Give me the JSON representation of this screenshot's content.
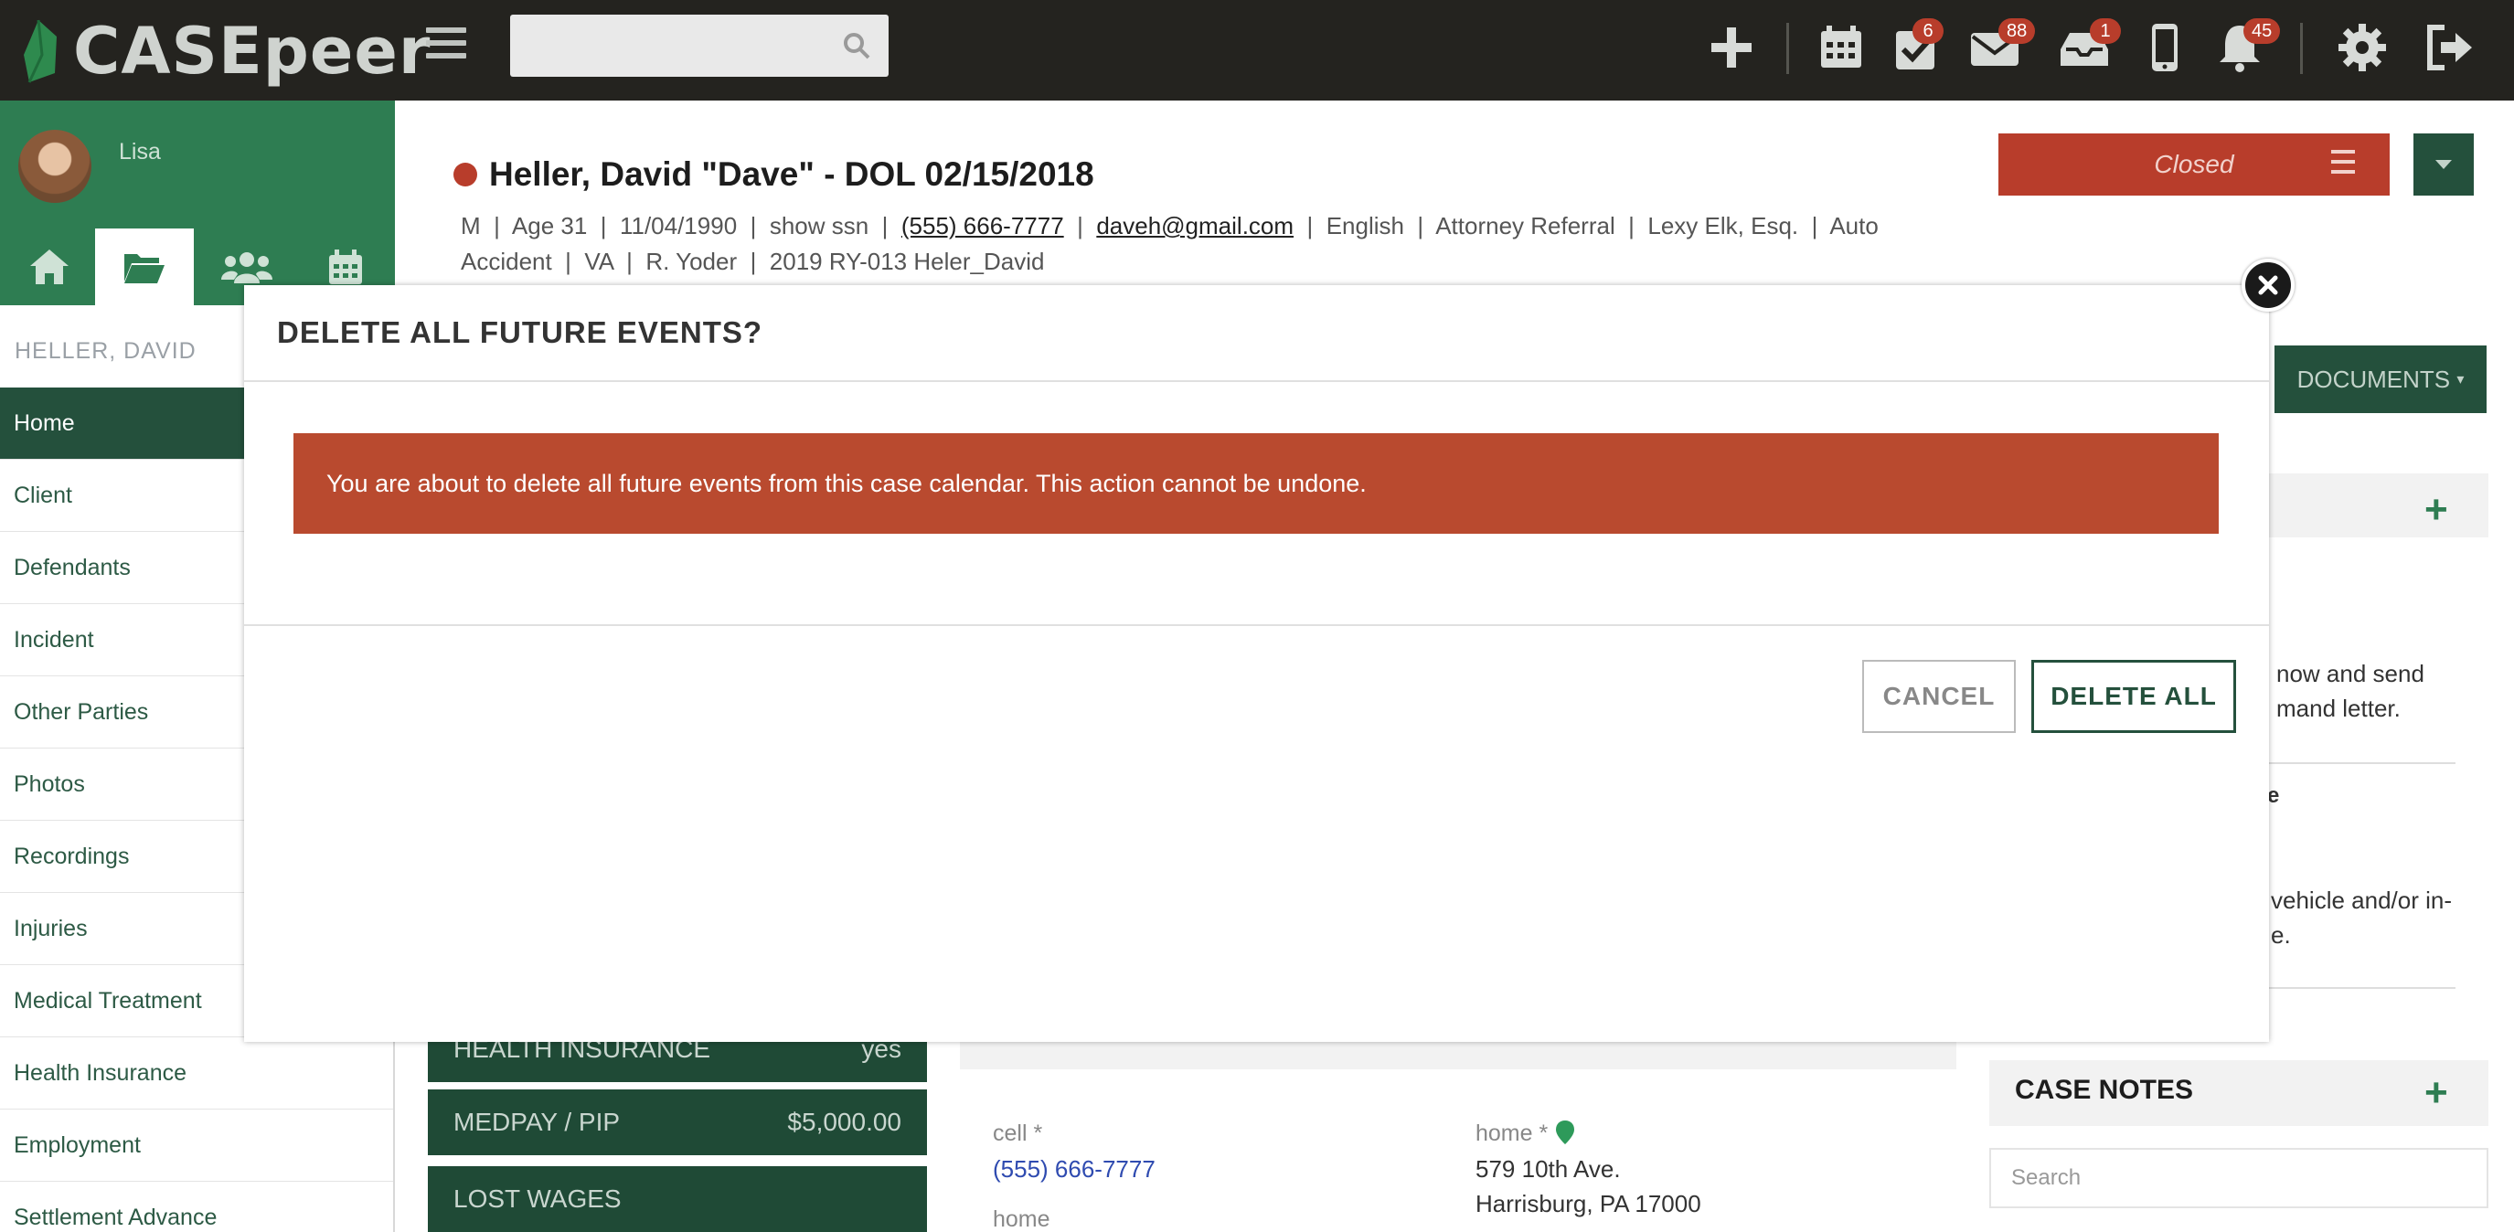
{
  "app": {
    "brand": "CASEpeer"
  },
  "topbar": {
    "search_placeholder": "",
    "badges": {
      "tasks": "6",
      "mail": "88",
      "inbox": "1",
      "notifications": "45"
    }
  },
  "sidebar": {
    "user_name": "Lisa",
    "case_label": "HELLER, DAVID",
    "items": [
      {
        "label": "Home"
      },
      {
        "label": "Client"
      },
      {
        "label": "Defendants"
      },
      {
        "label": "Incident"
      },
      {
        "label": "Other Parties"
      },
      {
        "label": "Photos"
      },
      {
        "label": "Recordings"
      },
      {
        "label": "Injuries"
      },
      {
        "label": "Medical Treatment"
      },
      {
        "label": "Health Insurance"
      },
      {
        "label": "Employment"
      },
      {
        "label": "Settlement Advance"
      }
    ]
  },
  "case": {
    "title": "Heller, David \"Dave\" - DOL 02/15/2018",
    "meta": {
      "gender": "M",
      "age": "Age 31",
      "dob": "11/04/1990",
      "ssn": "show ssn",
      "phone": "(555) 666-7777",
      "email": "daveh@gmail.com",
      "language": "English",
      "referral": "Attorney Referral",
      "attorney": "Lexy Elk, Esq.",
      "case_type_1": "Auto",
      "case_type_2": "Accident",
      "state": "VA",
      "staff": "R. Yoder",
      "case_number": "2019 RY-013 Heler_David"
    },
    "status": "Closed",
    "documents_label": "DOCUMENTS"
  },
  "right_panel": {
    "text_1a": "now and send",
    "text_1b": "mand letter.",
    "text_2": "e",
    "text_3a": "vehicle and/or in-",
    "text_3b": "e.",
    "case_notes_title": "CASE NOTES",
    "notes_search_placeholder": "Search"
  },
  "main": {
    "kpis": [
      {
        "label": "HEALTH INSURANCE",
        "value": "yes"
      },
      {
        "label": "MEDPAY / PIP",
        "value": "$5,000.00"
      },
      {
        "label": "LOST WAGES",
        "value": ""
      }
    ],
    "contact": {
      "cell_label": "cell *",
      "cell_value": "(555) 666-7777",
      "home_label": "home",
      "home_addr_label": "home *",
      "addr_line1": "579 10th Ave.",
      "addr_line2": "Harrisburg, PA 17000"
    }
  },
  "modal": {
    "title": "DELETE ALL FUTURE EVENTS?",
    "message": "You are about to delete all future events from this case calendar. This action cannot be undone.",
    "cancel_label": "CANCEL",
    "confirm_label": "DELETE ALL"
  }
}
